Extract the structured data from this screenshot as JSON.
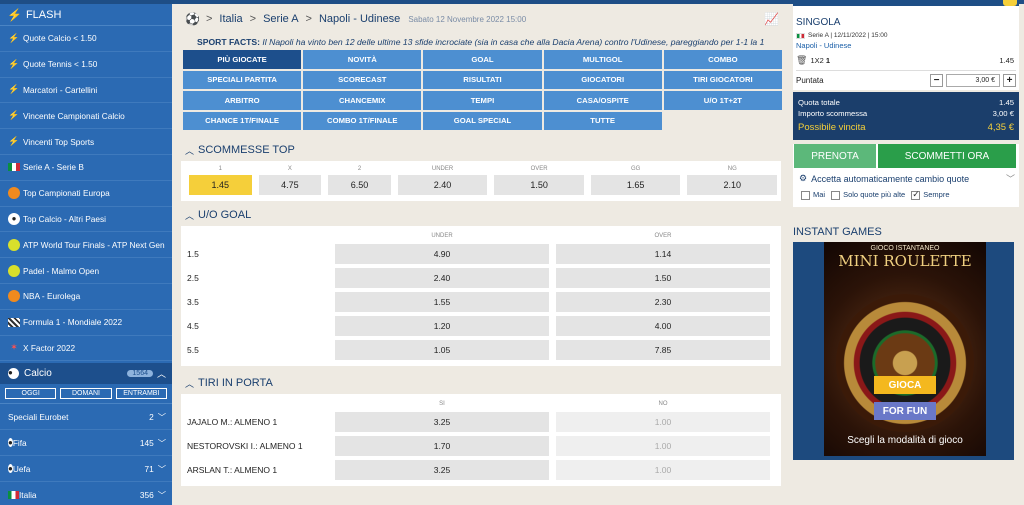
{
  "sidebar": {
    "flash_label": "FLASH",
    "items": [
      {
        "label": "Quote Calcio < 1.50",
        "icon": "bolt-icon"
      },
      {
        "label": "Quote Tennis < 1.50",
        "icon": "bolt-icon"
      },
      {
        "label": "Marcatori - Cartellini",
        "icon": "bolt-icon"
      },
      {
        "label": "Vincente Campionati Calcio",
        "icon": "bolt-icon"
      },
      {
        "label": "Vincenti Top Sports",
        "icon": "bolt-icon"
      },
      {
        "label": "Serie A - Serie B",
        "icon": "italy-flag-icon"
      },
      {
        "label": "Top Campionati Europa",
        "icon": "euro-ball-icon"
      },
      {
        "label": "Top Calcio - Altri Paesi",
        "icon": "soccer-ball-icon"
      },
      {
        "label": "ATP World Tour Finals - ATP Next Gen",
        "icon": "tennis-ball-icon"
      },
      {
        "label": "Padel - Malmo Open",
        "icon": "tennis-ball-icon"
      },
      {
        "label": "NBA - Eurolega",
        "icon": "basketball-icon"
      },
      {
        "label": "Formula 1 - Mondiale 2022",
        "icon": "checkered-flag-icon"
      },
      {
        "label": "X Factor 2022",
        "icon": "star-icon"
      }
    ],
    "calcio": {
      "label": "Calcio",
      "count": "1564",
      "tabs": [
        "OGGI",
        "DOMANI",
        "ENTRAMBI"
      ],
      "subitems": [
        {
          "label": "Speciali Eurobet",
          "count": "2"
        },
        {
          "label": "Fifa",
          "count": "145"
        },
        {
          "label": "Uefa",
          "count": "71"
        },
        {
          "label": "Italia",
          "count": "356"
        }
      ]
    }
  },
  "breadcrumb": {
    "sport": "Italia",
    "league": "Serie A",
    "match": "Napoli - Udinese",
    "date": "Sabato 12 Novembre 2022 15:00"
  },
  "facts": {
    "label": "SPORT FACTS:",
    "text": "Il Napoli ha vinto ben 12 delle ultime 13 sfide incrociate (sia in casa che alla Dacia Arena) contro l'Udinese, pareggiando per 1-1 la 1"
  },
  "market_tabs": [
    "PIÙ GIOCATE",
    "NOVITÀ",
    "GOAL",
    "MULTIGOL",
    "COMBO",
    "SPECIALI PARTITA",
    "SCORECAST",
    "RISULTATI",
    "GIOCATORI",
    "TIRI GIOCATORI",
    "ARBITRO",
    "CHANCEMIX",
    "TEMPI",
    "CASA/OSPITE",
    "U/O 1T+2T",
    "CHANCE 1T/FINALE",
    "COMBO 1T/FINALE",
    "GOAL SPECIAL",
    "TUTTE"
  ],
  "scommesse_top": {
    "title": "SCOMMESSE TOP",
    "odds": [
      {
        "label": "1",
        "value": "1.45"
      },
      {
        "label": "X",
        "value": "4.75"
      },
      {
        "label": "2",
        "value": "6.50"
      },
      {
        "label": "UNDER",
        "value": "2.40"
      },
      {
        "label": "OVER",
        "value": "1.50"
      },
      {
        "label": "GG",
        "value": "1.65"
      },
      {
        "label": "NG",
        "value": "2.10"
      }
    ]
  },
  "uo_goal": {
    "title": "U/O GOAL",
    "col1": "UNDER",
    "col2": "OVER",
    "rows": [
      {
        "line": "1.5",
        "under": "4.90",
        "over": "1.14"
      },
      {
        "line": "2.5",
        "under": "2.40",
        "over": "1.50"
      },
      {
        "line": "3.5",
        "under": "1.55",
        "over": "2.30"
      },
      {
        "line": "4.5",
        "under": "1.20",
        "over": "4.00"
      },
      {
        "line": "5.5",
        "under": "1.05",
        "over": "7.85"
      }
    ]
  },
  "tiri": {
    "title": "TIRI IN PORTA",
    "col1": "SI",
    "col2": "NO",
    "rows": [
      {
        "name": "JAJALO M.: ALMENO 1",
        "si": "3.25",
        "no": "1.00"
      },
      {
        "name": "NESTOROVSKI I.: ALMENO 1",
        "si": "1.70",
        "no": "1.00"
      },
      {
        "name": "ARSLAN T.: ALMENO 1",
        "si": "3.25",
        "no": "1.00"
      }
    ]
  },
  "betslip": {
    "title": "SINGOLA",
    "meta": "Serie A | 12/11/2022 | 15:00",
    "match": "Napoli - Udinese",
    "pick_market": "1X2",
    "pick_value": "1",
    "pick_odd": "1.45",
    "stake_label": "Puntata",
    "stake_value": "3,00 €",
    "quota_label": "Quota totale",
    "quota_value": "1.45",
    "importo_label": "Importo scommessa",
    "importo_value": "3,00 €",
    "vincita_label": "Possibile vincita",
    "vincita_value": "4,35 €",
    "prenota": "PRENOTA",
    "scommetti": "SCOMMETTI ORA",
    "accept": "Accetta automaticamente cambio quote",
    "check_mai": "Mai",
    "check_solo": "Solo quote più alte",
    "check_sempre": "Sempre"
  },
  "instant": {
    "title": "INSTANT GAMES",
    "game_tag": "GIOCO ISTANTANEO",
    "game_name": "MINI ROULETTE",
    "gioca": "GIOCA",
    "for_fun": "FOR FUN",
    "scegli": "Scegli la modalità di gioco"
  },
  "colors": {
    "brand": "#2b6ab3",
    "accent": "#f5cf3a",
    "green": "#2a9e4a"
  }
}
